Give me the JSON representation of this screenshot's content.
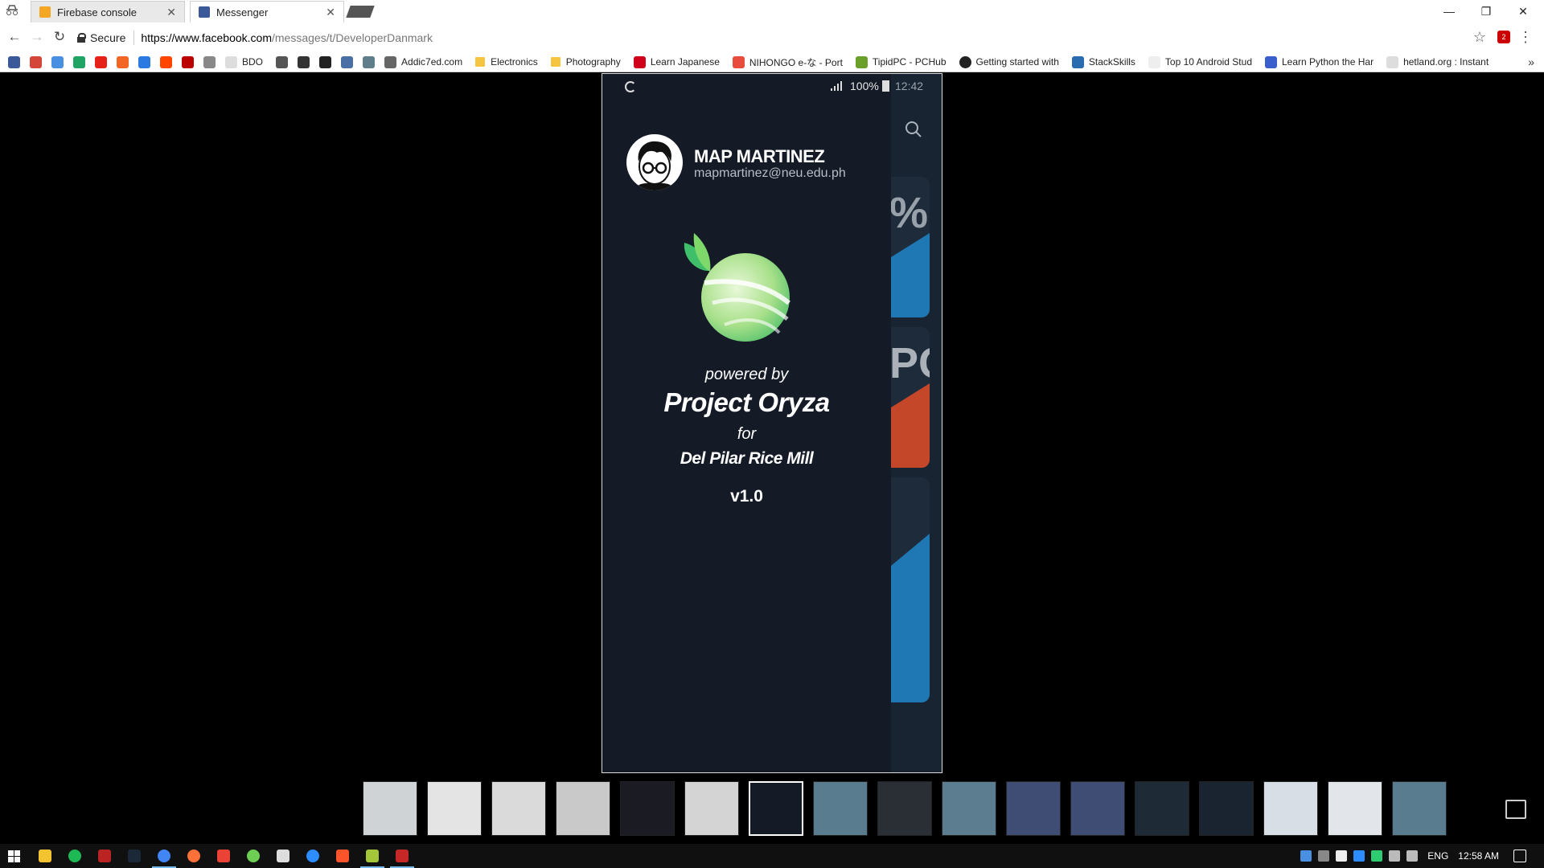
{
  "browser": {
    "tabs": [
      {
        "label": "Firebase console",
        "favicon": "firebase-icon",
        "color": "#f5a623"
      },
      {
        "label": "Messenger",
        "favicon": "facebook-icon",
        "color": "#3b5998"
      }
    ],
    "secure_label": "Secure",
    "url_host": "https://www.facebook.com",
    "url_path": "/messages/t/DeveloperDanmark",
    "ext_badge": "2"
  },
  "bookmarks": [
    {
      "label": "BDO",
      "icon": "page-icon"
    },
    {
      "label": "Addic7ed.com",
      "icon": "site-icon"
    },
    {
      "label": "Electronics",
      "icon": "folder-icon"
    },
    {
      "label": "Photography",
      "icon": "folder-icon"
    },
    {
      "label": "Learn Japanese",
      "icon": "tk-icon"
    },
    {
      "label": "NIHONGO e-な - Port",
      "icon": "page-icon"
    },
    {
      "label": "TipidPC - PCHub",
      "icon": "site-icon"
    },
    {
      "label": "Getting started with",
      "icon": "github-icon"
    },
    {
      "label": "StackSkills",
      "icon": "site-icon"
    },
    {
      "label": "Top 10 Android Stud",
      "icon": "page-icon"
    },
    {
      "label": "Learn Python the Har",
      "icon": "site-icon"
    },
    {
      "label": "hetland.org : Instant",
      "icon": "page-icon"
    }
  ],
  "phone": {
    "status": {
      "battery": "100%",
      "time": "12:42"
    },
    "user": {
      "name": "MAP MARTINEZ",
      "email": "mapmartinez@neu.edu.ph"
    },
    "splash": {
      "powered_by": "powered by",
      "product": "Project Oryza",
      "for": "for",
      "client": "Del Pilar Rice Mill",
      "version": "v1.0"
    },
    "behind_cards": [
      "%",
      "PC",
      ""
    ]
  },
  "taskbar": {
    "lang": "ENG",
    "time": "12:58 AM"
  },
  "colors": {
    "drawer_bg": "#141b26",
    "accent_green": "#7ed957",
    "card_blue": "#1f78b4",
    "card_orange": "#c4472a"
  }
}
